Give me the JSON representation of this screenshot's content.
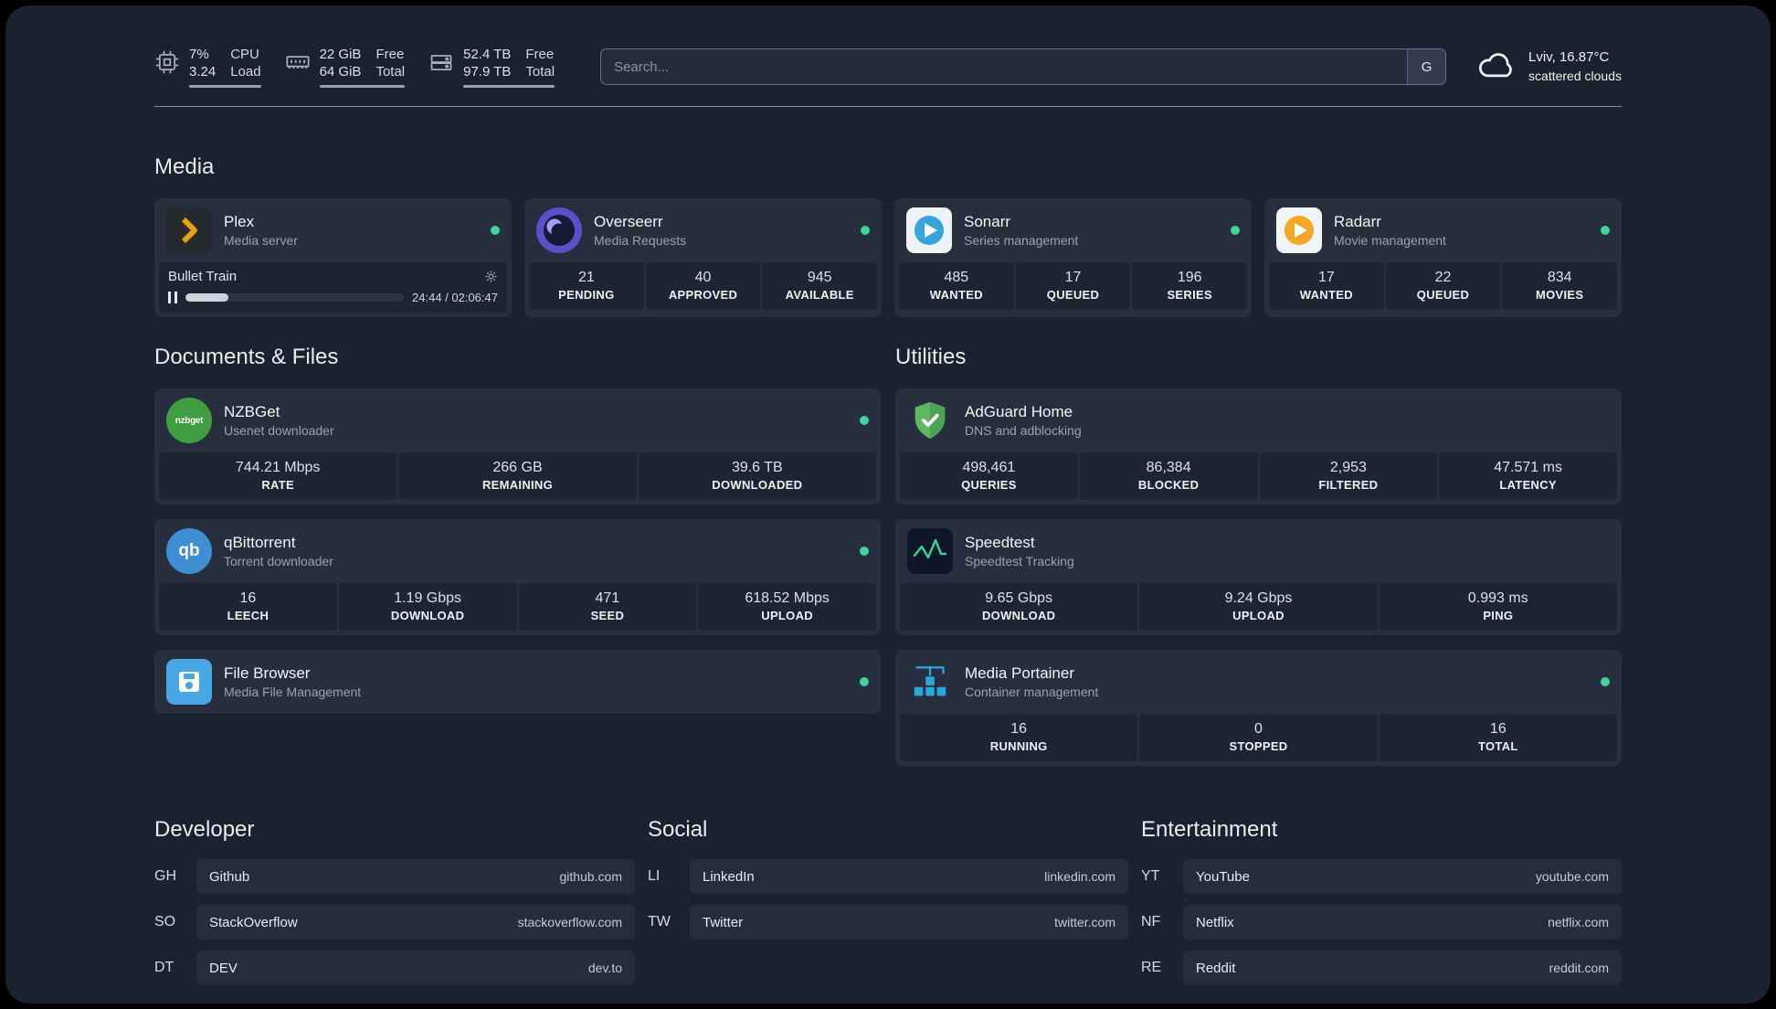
{
  "colors": {
    "background": "#1a2230",
    "card": "#272f3e",
    "stat_block": "#1d2534",
    "status_green": "#3ed598",
    "plex_amber": "#e5a00d"
  },
  "topbar": {
    "cpu": {
      "top_value": "7%",
      "bottom_value": "3.24",
      "top_label": "CPU",
      "bottom_label": "Load"
    },
    "memory": {
      "top_value": "22 GiB",
      "bottom_value": "64 GiB",
      "top_label": "Free",
      "bottom_label": "Total"
    },
    "disk": {
      "top_value": "52.4 TB",
      "bottom_value": "97.9 TB",
      "top_label": "Free",
      "bottom_label": "Total"
    },
    "search": {
      "placeholder": "Search...",
      "provider_button": "G"
    },
    "weather": {
      "location": "Lviv, 16.87°C",
      "condition": "scattered clouds"
    }
  },
  "sections": {
    "media": "Media",
    "documents": "Documents & Files",
    "utilities": "Utilities",
    "developer": "Developer",
    "social": "Social",
    "entertainment": "Entertainment"
  },
  "services": {
    "plex": {
      "name": "Plex",
      "desc": "Media server",
      "now_playing": "Bullet Train",
      "time": "24:44 / 02:06:47",
      "progress_style": "width:19.5%"
    },
    "overseerr": {
      "name": "Overseerr",
      "desc": "Media Requests",
      "stats": [
        {
          "value": "21",
          "label": "PENDING"
        },
        {
          "value": "40",
          "label": "APPROVED"
        },
        {
          "value": "945",
          "label": "AVAILABLE"
        }
      ]
    },
    "sonarr": {
      "name": "Sonarr",
      "desc": "Series management",
      "stats": [
        {
          "value": "485",
          "label": "WANTED"
        },
        {
          "value": "17",
          "label": "QUEUED"
        },
        {
          "value": "196",
          "label": "SERIES"
        }
      ]
    },
    "radarr": {
      "name": "Radarr",
      "desc": "Movie management",
      "stats": [
        {
          "value": "17",
          "label": "WANTED"
        },
        {
          "value": "22",
          "label": "QUEUED"
        },
        {
          "value": "834",
          "label": "MOVIES"
        }
      ]
    },
    "nzbget": {
      "name": "NZBGet",
      "desc": "Usenet downloader",
      "icon_text": "nzbget",
      "stats": [
        {
          "value": "744.21 Mbps",
          "label": "RATE"
        },
        {
          "value": "266 GB",
          "label": "REMAINING"
        },
        {
          "value": "39.6 TB",
          "label": "DOWNLOADED"
        }
      ]
    },
    "qbittorrent": {
      "name": "qBittorrent",
      "desc": "Torrent downloader",
      "icon_text": "qb",
      "stats": [
        {
          "value": "16",
          "label": "LEECH"
        },
        {
          "value": "1.19 Gbps",
          "label": "DOWNLOAD"
        },
        {
          "value": "471",
          "label": "SEED"
        },
        {
          "value": "618.52 Mbps",
          "label": "UPLOAD"
        }
      ]
    },
    "filebrowser": {
      "name": "File Browser",
      "desc": "Media File Management"
    },
    "adguard": {
      "name": "AdGuard Home",
      "desc": "DNS and adblocking",
      "stats": [
        {
          "value": "498,461",
          "label": "QUERIES"
        },
        {
          "value": "86,384",
          "label": "BLOCKED"
        },
        {
          "value": "2,953",
          "label": "FILTERED"
        },
        {
          "value": "47.571 ms",
          "label": "LATENCY"
        }
      ]
    },
    "speedtest": {
      "name": "Speedtest",
      "desc": "Speedtest Tracking",
      "stats": [
        {
          "value": "9.65 Gbps",
          "label": "DOWNLOAD"
        },
        {
          "value": "9.24 Gbps",
          "label": "UPLOAD"
        },
        {
          "value": "0.993 ms",
          "label": "PING"
        }
      ]
    },
    "portainer": {
      "name": "Media Portainer",
      "desc": "Container management",
      "stats": [
        {
          "value": "16",
          "label": "RUNNING"
        },
        {
          "value": "0",
          "label": "STOPPED"
        },
        {
          "value": "16",
          "label": "TOTAL"
        }
      ]
    }
  },
  "bookmarks": {
    "developer": [
      {
        "abbr": "GH",
        "name": "Github",
        "url": "github.com"
      },
      {
        "abbr": "SO",
        "name": "StackOverflow",
        "url": "stackoverflow.com"
      },
      {
        "abbr": "DT",
        "name": "DEV",
        "url": "dev.to"
      }
    ],
    "social": [
      {
        "abbr": "LI",
        "name": "LinkedIn",
        "url": "linkedin.com"
      },
      {
        "abbr": "TW",
        "name": "Twitter",
        "url": "twitter.com"
      }
    ],
    "entertainment": [
      {
        "abbr": "YT",
        "name": "YouTube",
        "url": "youtube.com"
      },
      {
        "abbr": "NF",
        "name": "Netflix",
        "url": "netflix.com"
      },
      {
        "abbr": "RE",
        "name": "Reddit",
        "url": "reddit.com"
      }
    ]
  }
}
